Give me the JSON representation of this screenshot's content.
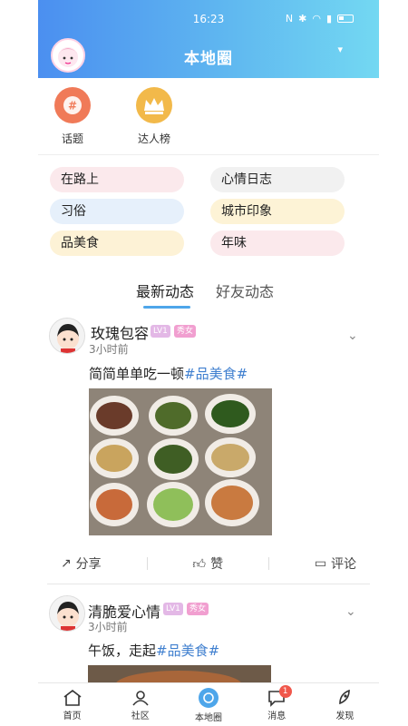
{
  "status_bar": {
    "time": "16:23",
    "icons": [
      "nfc-icon",
      "bluetooth-icon",
      "wifi-icon",
      "signal-icon",
      "battery-icon"
    ]
  },
  "header": {
    "title": "本地圈"
  },
  "quick_entries": [
    {
      "label": "话题",
      "icon": "hashtag-icon",
      "color": "#f07a58"
    },
    {
      "label": "达人榜",
      "icon": "crown-icon",
      "color": "#f2b94a"
    }
  ],
  "tags": [
    {
      "label": "在路上",
      "color": "#fbe9ec"
    },
    {
      "label": "心情日志",
      "color": "#f1f1f1"
    },
    {
      "label": "习俗",
      "color": "#e6f0fb"
    },
    {
      "label": "城市印象",
      "color": "#fdf3d6"
    },
    {
      "label": "品美食",
      "color": "#fdf2d6"
    },
    {
      "label": "年味",
      "color": "#fbe9ec"
    }
  ],
  "feed_tabs": [
    {
      "label": "最新动态",
      "active": true
    },
    {
      "label": "好友动态",
      "active": false
    }
  ],
  "posts": [
    {
      "name": "玫瑰包容",
      "level": "LV1",
      "gender": "秀女",
      "time": "3小时前",
      "text": "简简单单吃一顿",
      "hashtag": "#品美食#",
      "actions": {
        "share": "分享",
        "like": "赞",
        "comment": "评论"
      }
    },
    {
      "name": "清脆爱心情",
      "level": "LV1",
      "gender": "秀女",
      "time": "3小时前",
      "text": "午饭，走起",
      "hashtag": "#品美食#"
    }
  ],
  "bottom_nav": [
    {
      "label": "首页",
      "icon": "home-icon"
    },
    {
      "label": "社区",
      "icon": "community-icon"
    },
    {
      "label": "本地圈",
      "icon": "local-circle-icon",
      "active": true
    },
    {
      "label": "消息",
      "icon": "message-icon",
      "badge": "1"
    },
    {
      "label": "发现",
      "icon": "rocket-icon"
    }
  ],
  "colors": {
    "header_start": "#4b8ff0",
    "header_end": "#73d8f2",
    "accent": "#4ea6ea",
    "hashtag": "#3f7fcf",
    "badge_red": "#f0574b"
  }
}
